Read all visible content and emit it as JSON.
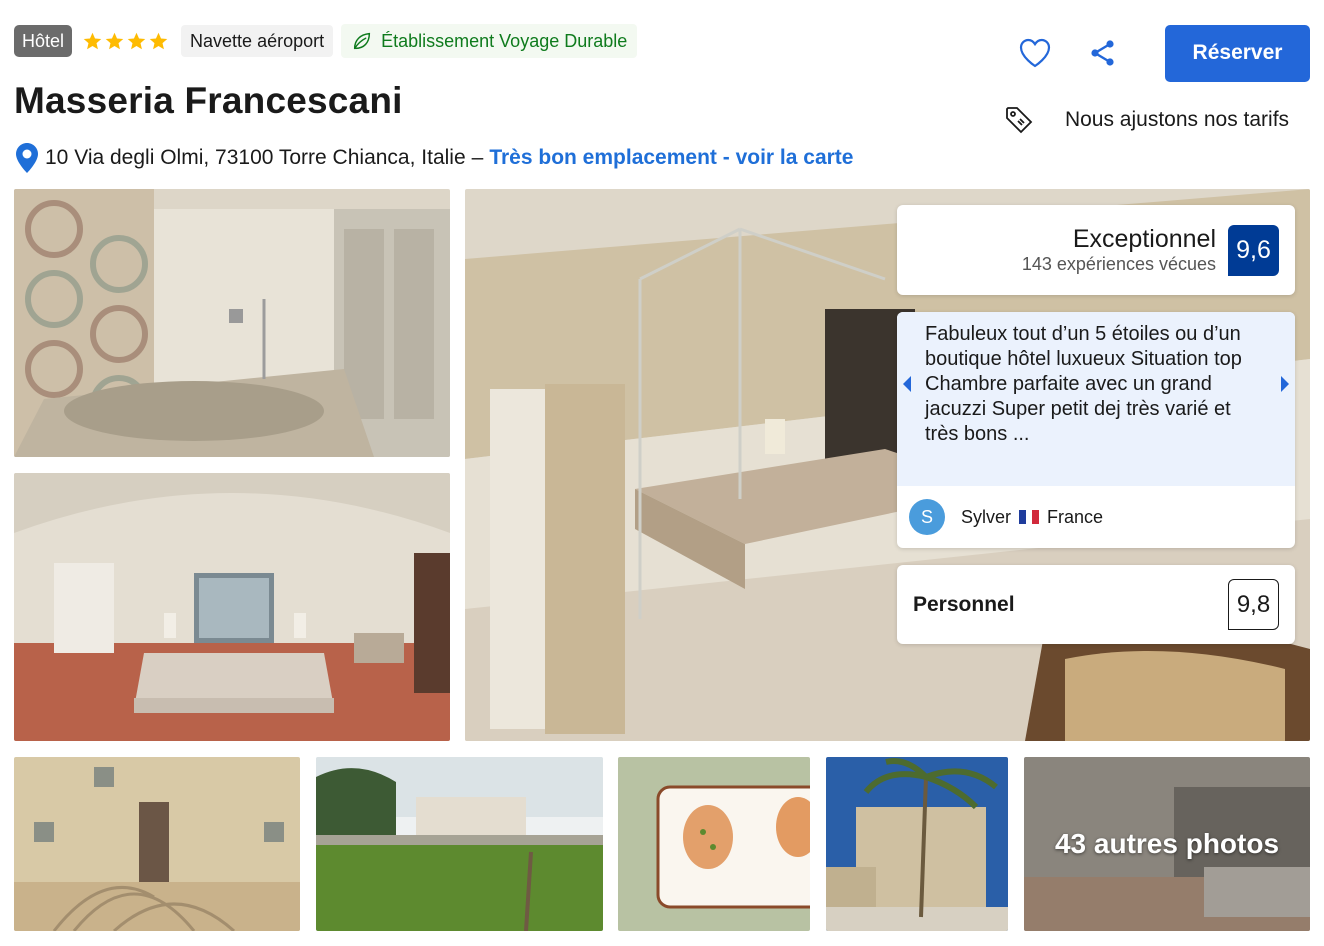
{
  "header": {
    "property_type": "Hôtel",
    "star_rating": 4,
    "amenity_badge": "Navette aéroport",
    "sustainability_badge": "Établissement Voyage Durable",
    "title": "Masseria Francescani",
    "address": "10 Via degli Olmi, 73100 Torre Chianca, Italie",
    "address_separator": "–",
    "map_link": "Très bon emplacement - voir la carte"
  },
  "actions": {
    "favorite_icon": "heart-icon",
    "share_icon": "share-icon",
    "book_label": "Réserver"
  },
  "price_match": {
    "icon": "tag-icon",
    "text": "Nous ajustons nos tarifs"
  },
  "review_score": {
    "label": "Exceptionnel",
    "count": "143 expériences vécues",
    "score": "9,6"
  },
  "featured_review": {
    "quote": "Fabuleux tout d’un 5 étoiles ou d’un boutique hôtel luxueux Situation top Chambre parfaite avec un grand jacuzzi Super petit dej très varié et très bons ...",
    "reviewer_initial": "S",
    "reviewer_name": "Sylver",
    "reviewer_country": "France"
  },
  "category_score": {
    "label": "Personnel",
    "score": "9,8"
  },
  "gallery": {
    "more_photos": "43 autres photos"
  },
  "colors": {
    "primary_blue": "#2367d9",
    "score_blue": "#003b95",
    "link_blue": "#1f6fd8",
    "sustainable_green": "#0f7b1d",
    "star_yellow": "#febb02"
  }
}
